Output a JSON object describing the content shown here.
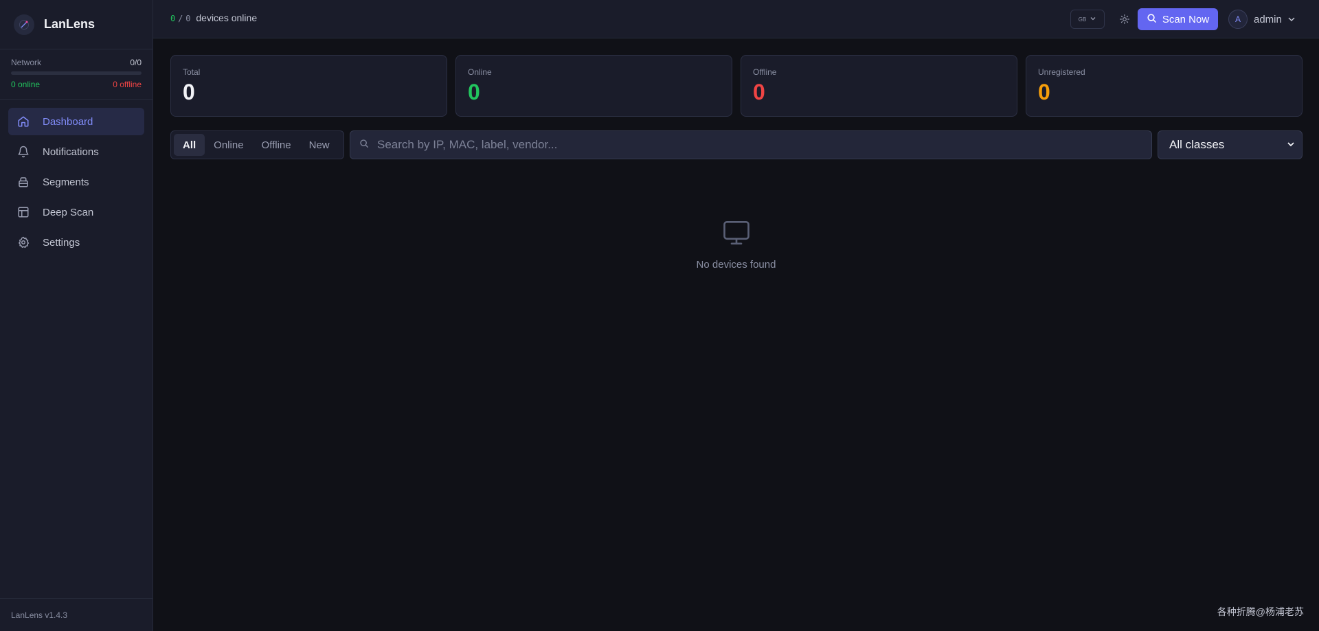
{
  "app": {
    "name": "LanLens",
    "version": "LanLens v1.4.3"
  },
  "network": {
    "label": "Network",
    "count": "0/0",
    "online": "0 online",
    "offline": "0 offline",
    "fill_fraction": 0
  },
  "nav": {
    "items": [
      {
        "label": "Dashboard",
        "icon": "home-icon",
        "active": true
      },
      {
        "label": "Notifications",
        "icon": "bell-icon"
      },
      {
        "label": "Segments",
        "icon": "layers-icon"
      },
      {
        "label": "Deep Scan",
        "icon": "table-icon"
      },
      {
        "label": "Settings",
        "icon": "gear-icon"
      }
    ]
  },
  "topbar": {
    "online_count": "0",
    "separator": "/",
    "total_count": "0",
    "online_suffix": "devices online",
    "language": "GB",
    "scan_label": "Scan Now",
    "avatar_initial": "A",
    "username": "admin"
  },
  "stats": [
    {
      "label": "Total",
      "value": "0",
      "color": "#f1f2f6"
    },
    {
      "label": "Online",
      "value": "0",
      "color": "#22c55e"
    },
    {
      "label": "Offline",
      "value": "0",
      "color": "#ef4444"
    },
    {
      "label": "Unregistered",
      "value": "0",
      "color": "#f59e0b"
    }
  ],
  "filters": [
    "All",
    "Online",
    "Offline",
    "New"
  ],
  "search": {
    "placeholder": "Search by IP, MAC, label, vendor..."
  },
  "class_filter": {
    "selected": "All classes"
  },
  "empty_state": {
    "icon": "monitor-icon",
    "text": "No devices found"
  },
  "watermark": "各种折腾@杨浦老苏",
  "colors": {
    "accent": "#6366f1",
    "online": "#22c55e",
    "offline": "#ef4444",
    "warning": "#f59e0b"
  }
}
